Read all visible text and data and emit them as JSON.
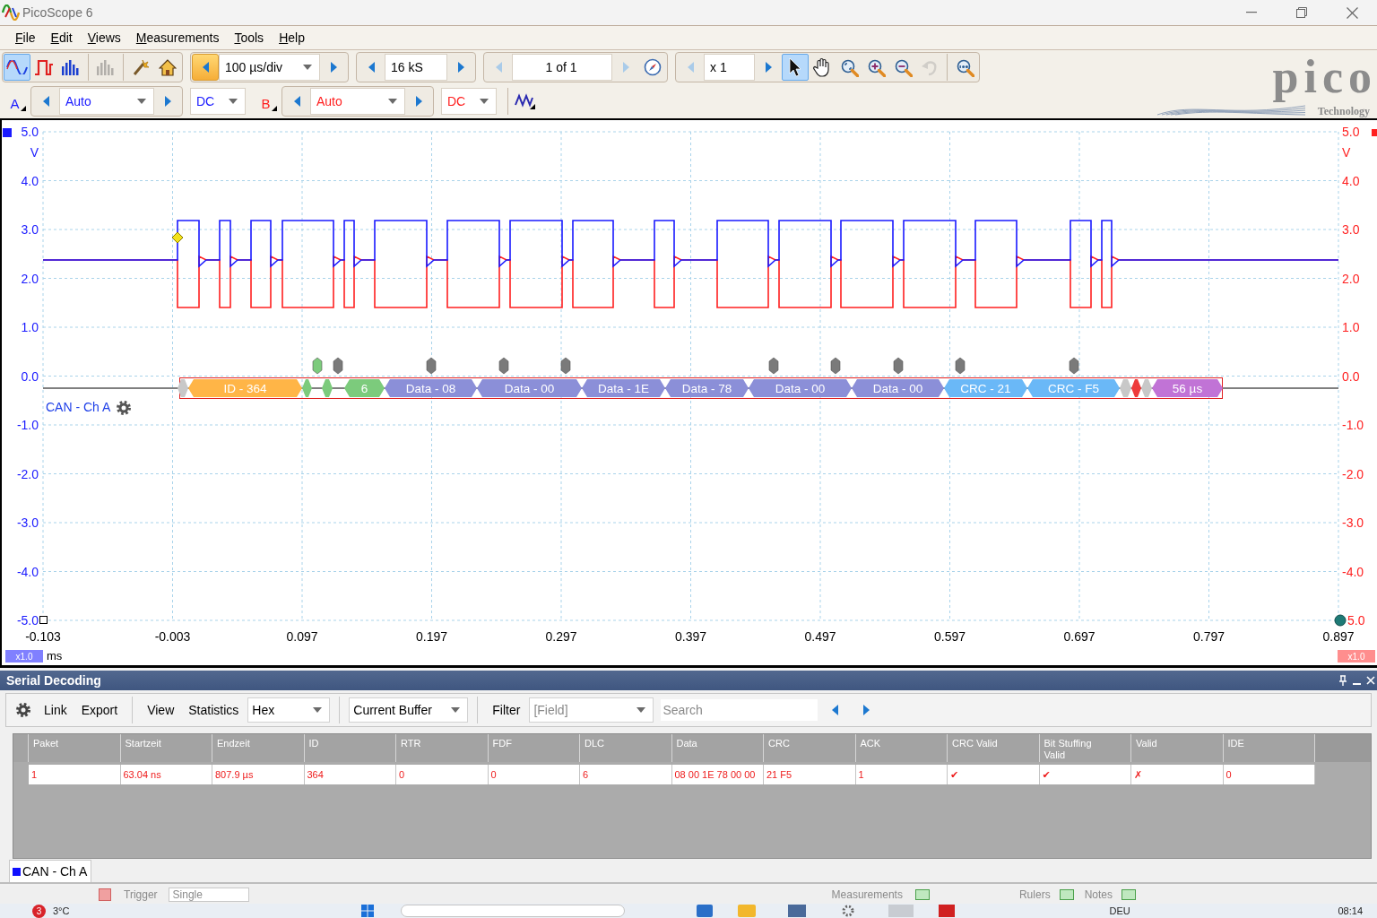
{
  "window": {
    "title": "PicoScope 6"
  },
  "menu": [
    "File",
    "Edit",
    "Views",
    "Measurements",
    "Tools",
    "Help"
  ],
  "toolbar": {
    "view_modes": [
      {
        "kind": "scope",
        "selected": true,
        "disabled": false
      },
      {
        "kind": "persistence",
        "selected": false,
        "disabled": false
      },
      {
        "kind": "spectrum",
        "selected": false,
        "disabled": false
      },
      {
        "kind": "spectrum",
        "selected": false,
        "disabled": true
      }
    ],
    "timebase": {
      "value": "100 µs/div",
      "prev_enabled": true,
      "next_enabled": true,
      "prev_hover": true
    },
    "samples": {
      "value": "16 kS",
      "prev_enabled": true,
      "next_enabled": true,
      "prev_hover": false
    },
    "buffer": {
      "value": "1 of 1",
      "prev_enabled": false,
      "next_enabled": false,
      "prev_hover": false
    },
    "zoom": {
      "value": "x 1",
      "prev_enabled": false,
      "next_enabled": true,
      "prev_hover": false
    },
    "tools": [
      {
        "kind": "pointer",
        "selected": true,
        "disabled": false
      },
      {
        "kind": "hand",
        "selected": false,
        "disabled": false
      },
      {
        "kind": "zoom-region",
        "selected": false,
        "disabled": false
      },
      {
        "kind": "zoom-in",
        "selected": false,
        "disabled": false
      },
      {
        "kind": "zoom-out",
        "selected": false,
        "disabled": false
      },
      {
        "kind": "undo-zoom",
        "selected": false,
        "disabled": true
      },
      {
        "kind": "zoom-full",
        "selected": false,
        "disabled": false
      }
    ]
  },
  "channels": [
    {
      "name": "A",
      "range": "Auto",
      "coupling": "DC",
      "color": "#1a1aff"
    },
    {
      "name": "B",
      "range": "Auto",
      "coupling": "DC",
      "color": "#ff2020"
    }
  ],
  "logo": {
    "name": "pico",
    "tagline": "Technology"
  },
  "scope": {
    "left_axis": {
      "ticks": [
        "5.0",
        "4.0",
        "3.0",
        "2.0",
        "1.0",
        "0.0",
        "-1.0",
        "-2.0",
        "-3.0",
        "-4.0",
        "-5.0"
      ],
      "unit": "V"
    },
    "right_axis": {
      "ticks": [
        "5.0",
        "4.0",
        "3.0",
        "2.0",
        "1.0",
        "0.0",
        "-1.0",
        "-2.0",
        "-3.0",
        "-4.0",
        "5.0"
      ],
      "unit": "V"
    },
    "time_axis": {
      "ticks": [
        "-0.103",
        "-0.003",
        "0.097",
        "0.197",
        "0.297",
        "0.397",
        "0.497",
        "0.597",
        "0.697",
        "0.797",
        "0.897"
      ],
      "unit": "ms",
      "zoom_left": "x1.0",
      "zoom_right": "x1.0"
    },
    "decoder": {
      "label": "CAN - Ch A",
      "fields": [
        {
          "kind": "bit",
          "color": "#c8c8c8"
        },
        {
          "kind": "field",
          "label": "ID - 364",
          "color": "#ffb547"
        },
        {
          "kind": "bit",
          "color": "#7ccb7c"
        },
        {
          "kind": "bit",
          "color": "#7ccb7c"
        },
        {
          "kind": "field",
          "label": "6",
          "color": "#7ccb7c"
        },
        {
          "kind": "field",
          "label": "Data - 08",
          "color": "#8b8fd8"
        },
        {
          "kind": "field",
          "label": "Data - 00",
          "color": "#8b8fd8"
        },
        {
          "kind": "field",
          "label": "Data - 1E",
          "color": "#8b8fd8"
        },
        {
          "kind": "field",
          "label": "Data - 78",
          "color": "#8b8fd8"
        },
        {
          "kind": "field",
          "label": "Data - 00",
          "color": "#8b8fd8"
        },
        {
          "kind": "field",
          "label": "Data - 00",
          "color": "#8b8fd8"
        },
        {
          "kind": "field",
          "label": "CRC - 21",
          "color": "#6ab8f7"
        },
        {
          "kind": "field",
          "label": "CRC - F5",
          "color": "#6ab8f7"
        },
        {
          "kind": "bit",
          "color": "#c8c8c8"
        },
        {
          "kind": "bit",
          "color": "#ee3b3b"
        },
        {
          "kind": "bit",
          "color": "#c8c8c8"
        },
        {
          "kind": "field",
          "label": "56 µs",
          "color": "#c173d6"
        }
      ],
      "markers": [
        {
          "color": "#7ccb7c"
        },
        {
          "color": "#7a7a7a"
        },
        {
          "color": "#7a7a7a"
        },
        {
          "color": "#7a7a7a"
        },
        {
          "color": "#7a7a7a"
        },
        {
          "color": "#7a7a7a"
        },
        {
          "color": "#7a7a7a"
        },
        {
          "color": "#7a7a7a"
        },
        {
          "color": "#7a7a7a"
        },
        {
          "color": "#7a7a7a"
        }
      ]
    }
  },
  "serial_decoding": {
    "title": "Serial Decoding",
    "toolbar": {
      "action_groups": [
        [
          "Link",
          "Export"
        ],
        [
          "View",
          "Statistics"
        ]
      ],
      "format": "Hex",
      "source": "Current Buffer",
      "filter": "Filter",
      "field": {
        "placeholder": "[Field]"
      },
      "search": {
        "placeholder": "Search"
      }
    },
    "table": {
      "columns": [
        "Paket",
        "Startzeit",
        "Endzeit",
        "ID",
        "RTR",
        "FDF",
        "DLC",
        "Data",
        "CRC",
        "ACK",
        "CRC Valid",
        "Bit Stuffing Valid",
        "Valid",
        "IDE"
      ],
      "rows": [
        [
          "1",
          "63.04 ns",
          "807.9 µs",
          "364",
          "0",
          "0",
          "6",
          "08 00 1E 78 00 00",
          "21 F5",
          "1",
          "✔",
          "✔",
          "✗",
          "0"
        ]
      ]
    },
    "tabs": [
      {
        "label": "CAN - Ch A",
        "selected": true,
        "color": "#1010ff"
      }
    ]
  },
  "status_bar": {
    "trigger_label": "Trigger",
    "trigger_mode": "Single",
    "measurements": "Measurements",
    "rulers": "Rulers",
    "notes": "Notes"
  },
  "taskbar": {
    "badge": "3",
    "weather": "3°C",
    "language": "DEU",
    "time": "08:14"
  }
}
